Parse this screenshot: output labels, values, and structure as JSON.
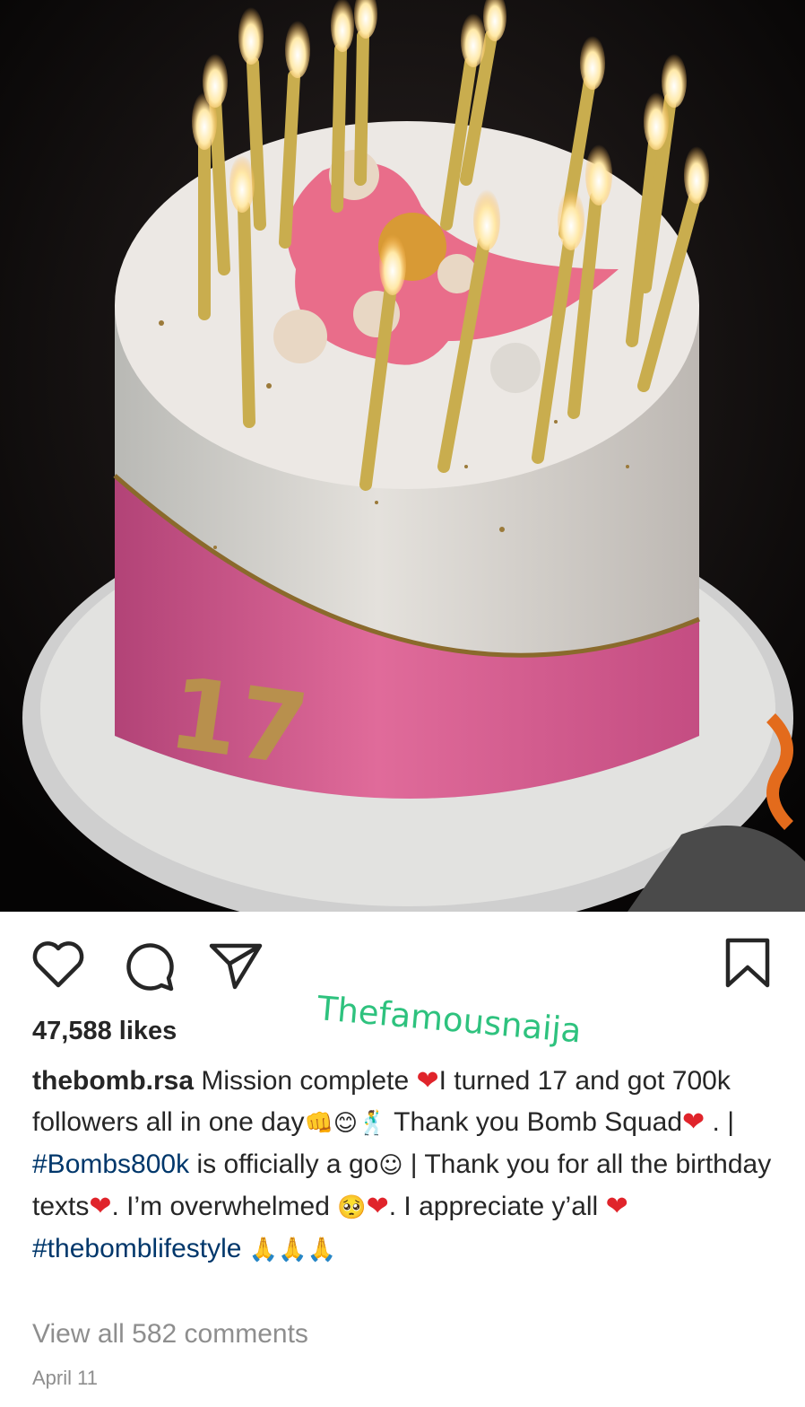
{
  "post": {
    "image_description_icon": "photo",
    "cake_number": "17",
    "watermark": "Thefamousnaija",
    "likes_text": "47,588 likes",
    "caption": {
      "username": "thebomb.rsa",
      "seg1": "Mission complete ",
      "heart": "❤",
      "seg2": "I turned 17 and got 700k followers all in one day",
      "emoji_fist": "👊",
      "emoji_smile": "😊",
      "emoji_dance": "🕺",
      "seg3": " Thank you Bomb Squad",
      "seg4": " . | ",
      "hashtag1": "#Bombs800k",
      "seg5": " is officially a go",
      "emoji_relieved": "☺",
      "seg6": " | Thank you for all the birthday texts",
      "seg7": ". I’m overwhelmed ",
      "emoji_pleading": "🥺",
      "seg8": ". I appreciate y’all ",
      "hashtag2": "#thebomblifestyle",
      "emoji_pray": "🙏🙏🙏"
    },
    "comments_text": "View all 582 comments",
    "date_text": "April 11"
  },
  "icons": {
    "like": "heart-outline-icon",
    "comment": "comment-bubble-icon",
    "share": "paper-plane-icon",
    "save": "bookmark-icon"
  }
}
